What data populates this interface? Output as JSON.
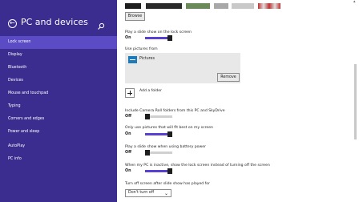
{
  "sidebar": {
    "title": "PC and devices",
    "back_icon": "arrow-left-icon",
    "search_icon": "search-icon",
    "items": [
      {
        "label": "Lock screen",
        "active": true
      },
      {
        "label": "Display",
        "active": false
      },
      {
        "label": "Bluetooth",
        "active": false
      },
      {
        "label": "Devices",
        "active": false
      },
      {
        "label": "Mouse and touchpad",
        "active": false
      },
      {
        "label": "Typing",
        "active": false
      },
      {
        "label": "Corners and edges",
        "active": false
      },
      {
        "label": "Power and sleep",
        "active": false
      },
      {
        "label": "AutoPlay",
        "active": false
      },
      {
        "label": "PC info",
        "active": false
      }
    ]
  },
  "content": {
    "browse_label": "Browse",
    "slideshow": {
      "label": "Play a slide show on the lock screen",
      "state": "On"
    },
    "use_pictures": {
      "label": "Use pictures from",
      "folder": "Pictures",
      "folder_icon": "folder-icon",
      "remove_label": "Remove"
    },
    "add_folder": {
      "label": "Add a folder",
      "icon": "plus-icon"
    },
    "camera_roll": {
      "label": "Include Camera Roll folders from this PC and SkyDrive",
      "state": "Off"
    },
    "best_fit": {
      "label": "Only use pictures that will fit best on my screen",
      "state": "On"
    },
    "battery": {
      "label": "Play a slide show when using battery power",
      "state": "Off"
    },
    "inactive": {
      "label": "When my PC is inactive, show the lock screen instead of turning off the screen",
      "state": "On"
    },
    "turn_off": {
      "label": "Turn off screen after slide show has played for",
      "selected": "Don't turn off"
    }
  },
  "colors": {
    "sidebar_bg": "#3b2d8f",
    "active_item": "#5b4bc4",
    "accent": "#5a3fd3"
  }
}
